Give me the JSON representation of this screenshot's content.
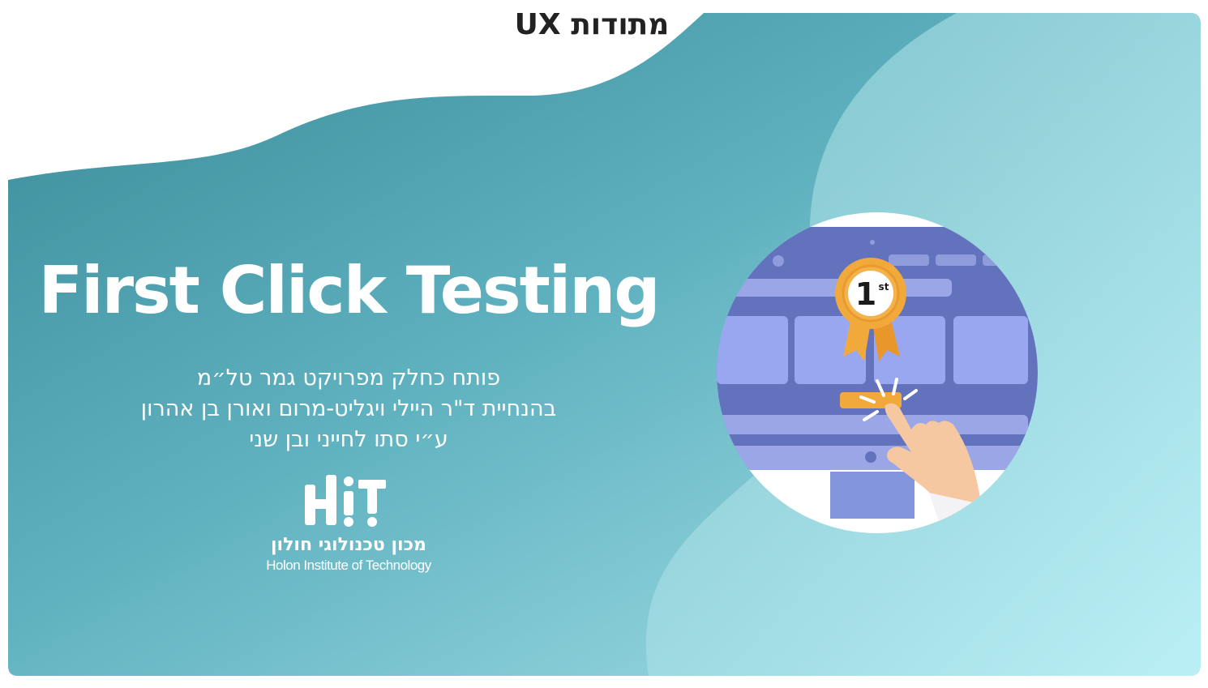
{
  "slide": {
    "category_label": "מתודות UX",
    "title": "First Click Testing",
    "subtitle_lines": [
      "פותח כחלק מפרויקט גמר טל״מ",
      "בהנחיית ד\"ר היילי ויגליט-מרום ואורן בן אהרון",
      "ע״י סתו לחייני ובן שני"
    ]
  },
  "logo": {
    "mark": "HiT",
    "name_he": "מכון טכנולוגי חולון",
    "name_en": "Holon Institute of Technology"
  },
  "illustration": {
    "badge_rank": "1",
    "badge_suffix": "st"
  },
  "colors": {
    "teal_dark": "#3a8d9b",
    "teal_light": "#b7eef3",
    "screen_purple": "#6272bd",
    "card_blue": "#99a7f0",
    "badge_orange": "#f2a93b",
    "skin": "#f6c8a2"
  }
}
